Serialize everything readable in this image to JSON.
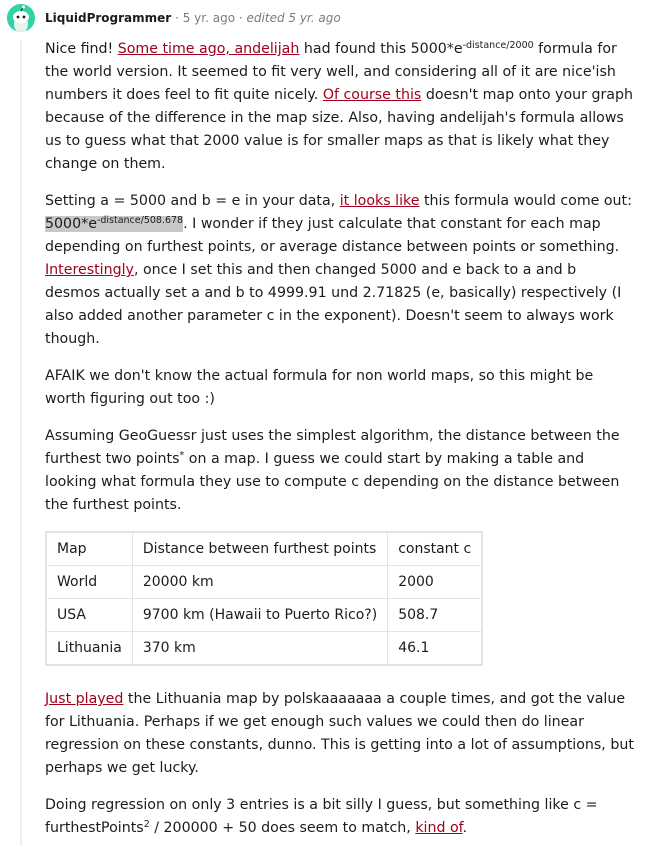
{
  "comment": {
    "author": "LiquidProgrammer",
    "sep1": "·",
    "age": "5 yr. ago",
    "sep2": "·",
    "edited": "edited 5 yr. ago"
  },
  "p1": {
    "t1": "Nice find! ",
    "link1": "Some time ago, andelijah",
    "t2": " had found this 5000*e",
    "sup1": "-distance/2000",
    "t3": " formula for the world version. It seemed to fit very well, and considering all of it are nice'ish numbers it does feel to fit quite nicely. ",
    "link2": "Of course this",
    "t4": " doesn't map onto your graph because of the difference in the map size. Also, having andelijah's formula allows us to guess what that 2000 value is for smaller maps as that is likely what they change on them."
  },
  "p2": {
    "t1": "Setting a = 5000 and b = e in your data, ",
    "link1": "it looks like",
    "t2": " this formula would come out: ",
    "hl_base": "5000*e",
    "hl_sup": "-distance/508.678",
    "t3": ". I wonder if they just calculate that constant for each map depending on furthest points, or average distance between points or something. ",
    "link2": "Interestingly",
    "t4": ", once I set this and then changed 5000 and e back to a and b desmos actually set a and b to 4999.91 und 2.71825 (e, basically) respectively (I also added another parameter c in the exponent). Doesn't seem to always work though."
  },
  "p3": "AFAIK we don't know the actual formula for non world maps, so this might be worth figuring out too :)",
  "p4": {
    "t1": "Assuming GeoGuessr just uses the simplest algorithm, the distance between the furthest two points",
    "sup": "*",
    "t2": " on a map. I guess we could start by making a table and looking what formula they use to compute c depending on the distance between the furthest points."
  },
  "table": {
    "headers": [
      "Map",
      "Distance between furthest points",
      "constant c"
    ],
    "rows": [
      [
        "World",
        "20000 km",
        "2000"
      ],
      [
        "USA",
        "9700 km (Hawaii to Puerto Rico?)",
        "508.7"
      ],
      [
        "Lithuania",
        "370 km",
        "46.1"
      ]
    ]
  },
  "p5": {
    "link1": "Just played",
    "t1": " the Lithuania map by polskaaaaaaa a couple times, and got the value for Lithuania. Perhaps if we get enough such values we could then do linear regression on these constants, dunno. This is getting into a lot of assumptions, but perhaps we get lucky."
  },
  "p6": {
    "t1": "Doing regression on only 3 entries is a bit silly I guess, but something like c = furthestPoints",
    "sup": "2",
    "t2": " / 200000 + 50 does seem to match, ",
    "link1": "kind of",
    "t3": "."
  }
}
